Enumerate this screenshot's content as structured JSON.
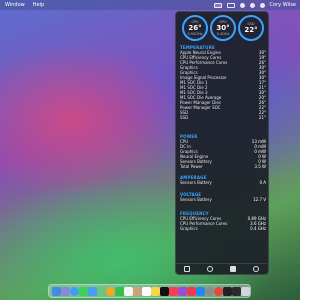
{
  "menubar": {
    "left": [
      "Window",
      "Help"
    ],
    "user": "Cory Wilse"
  },
  "gauges": [
    {
      "label": "CPU",
      "value": "26°",
      "sub": "0.55GHz"
    },
    {
      "label": "GPU",
      "value": "30°",
      "sub": "0.4GHz"
    },
    {
      "label": "SSD",
      "value": "22°",
      "sub": ""
    }
  ],
  "temperature": {
    "title": "TEMPERATURE",
    "rows": [
      {
        "label": "Apple Neural Engine",
        "value": "30°"
      },
      {
        "label": "CPU Efficiency Cores",
        "value": "19°"
      },
      {
        "label": "CPU Performance Cores",
        "value": "26°"
      },
      {
        "label": "Graphics",
        "value": "30°"
      },
      {
        "label": "Graphics",
        "value": "30°"
      },
      {
        "label": "Image Signal Processor",
        "value": "30°"
      },
      {
        "label": "M1 SOC Die 1",
        "value": "17°"
      },
      {
        "label": "M1 SOC Die 2",
        "value": "21°"
      },
      {
        "label": "M1 SOC Die 3",
        "value": "30°"
      },
      {
        "label": "M1 SOC Die Average",
        "value": "20°"
      },
      {
        "label": "Power Manager Dies",
        "value": "26°"
      },
      {
        "label": "Power Manager SOC",
        "value": "22°"
      },
      {
        "label": "SSD",
        "value": "22°"
      },
      {
        "label": "SSD",
        "value": "21°"
      }
    ]
  },
  "power": {
    "title": "POWER",
    "rows": [
      {
        "label": "CPU",
        "value": "13 mW"
      },
      {
        "label": "DC In",
        "value": "0 mW"
      },
      {
        "label": "Graphics",
        "value": "0 mW"
      },
      {
        "label": "Neural Engine",
        "value": "0 W"
      },
      {
        "label": "Sensors Battery",
        "value": "0 W"
      },
      {
        "label": "Total Power",
        "value": "3.5 W"
      }
    ]
  },
  "amperage": {
    "title": "AMPERAGE",
    "rows": [
      {
        "label": "Sensors Battery",
        "value": "0 A"
      }
    ]
  },
  "voltage": {
    "title": "VOLTAGE",
    "rows": [
      {
        "label": "Sensors Battery",
        "value": "12.7 V"
      }
    ]
  },
  "frequency": {
    "title": "FREQUENCY",
    "rows": [
      {
        "label": "CPU Efficiency Cores",
        "value": "0.89 GHz"
      },
      {
        "label": "CPU Performance Cores",
        "value": "3.6 GHz"
      },
      {
        "label": "Graphics",
        "value": "0.4 GHz"
      }
    ]
  },
  "footer_icons": [
    "gear-icon",
    "refresh-icon",
    "save-icon",
    "power-icon"
  ],
  "dock_apps": [
    "finder",
    "launchpad",
    "safari",
    "messages",
    "mail",
    "maps",
    "photos",
    "facetime",
    "calendar",
    "contacts",
    "reminders",
    "notes",
    "tv",
    "music",
    "podcasts",
    "news",
    "app-store",
    "system-settings",
    "chrome",
    "terminal",
    "activity-monitor",
    "trash"
  ]
}
